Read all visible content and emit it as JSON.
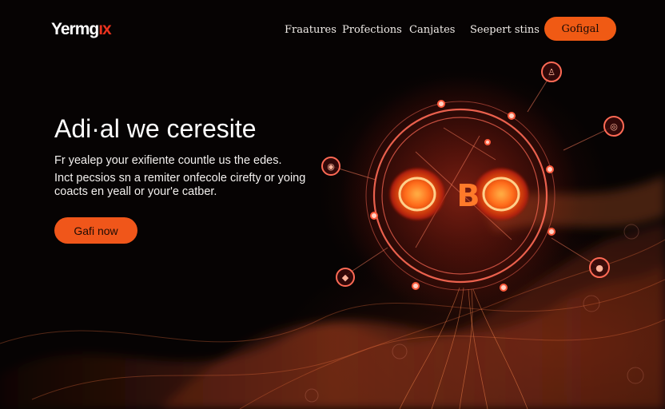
{
  "brand": {
    "name_main": "Yermg",
    "name_accent": "ıx",
    "accent_color": "#e8321e"
  },
  "nav": {
    "items": [
      {
        "label": "Fraatures"
      },
      {
        "label": "Profections"
      },
      {
        "label": "Canjates"
      },
      {
        "label": "Seepert stins"
      }
    ],
    "cta_label": "Gofigal"
  },
  "hero": {
    "title": "Adi·al  we ceresite",
    "lines": [
      "Fr yealep your exifiente countle us the edes.",
      "Inct pecsios sn a remiter onfecole cirefty or yoing",
      "coacts en yeall or your'e catber."
    ],
    "button_label": "Gafi now"
  },
  "artwork": {
    "center_text": "OBO",
    "glow_color": "#ff5a2a",
    "accent_orange": "#f05a14"
  }
}
